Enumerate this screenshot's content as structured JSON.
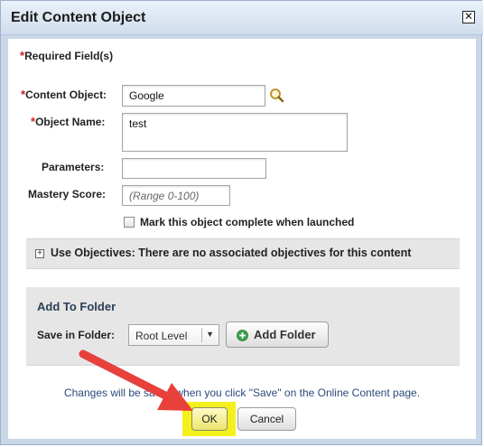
{
  "dialog": {
    "title": "Edit Content Object",
    "close_icon": "close-x-icon"
  },
  "form": {
    "required_note": "Required Field(s)",
    "required_marker": "*",
    "content_object_label": "Content Object:",
    "content_object_value": "Google",
    "search_icon": "magnifier-icon",
    "object_name_label": "Object Name:",
    "object_name_value": "test",
    "parameters_label": "Parameters:",
    "parameters_value": "",
    "mastery_label": "Mastery Score:",
    "mastery_placeholder": "(Range 0-100)",
    "complete_checkbox_label": "Mark this object complete when launched",
    "complete_checked": false
  },
  "objectives": {
    "expand_icon": "plus-box-icon",
    "label": "Use Objectives: There are no associated objectives for this content"
  },
  "folder": {
    "heading": "Add To Folder",
    "save_label": "Save in Folder:",
    "selected": "Root Level",
    "add_button": "Add Folder",
    "add_icon": "plus-circle-icon"
  },
  "footer": {
    "note": "Changes will be saved when you click \"Save\" on the Online Content page.",
    "ok": "OK",
    "cancel": "Cancel"
  },
  "annotation": {
    "arrow_color": "#e8403a",
    "highlight_color": "#f5f21e"
  }
}
